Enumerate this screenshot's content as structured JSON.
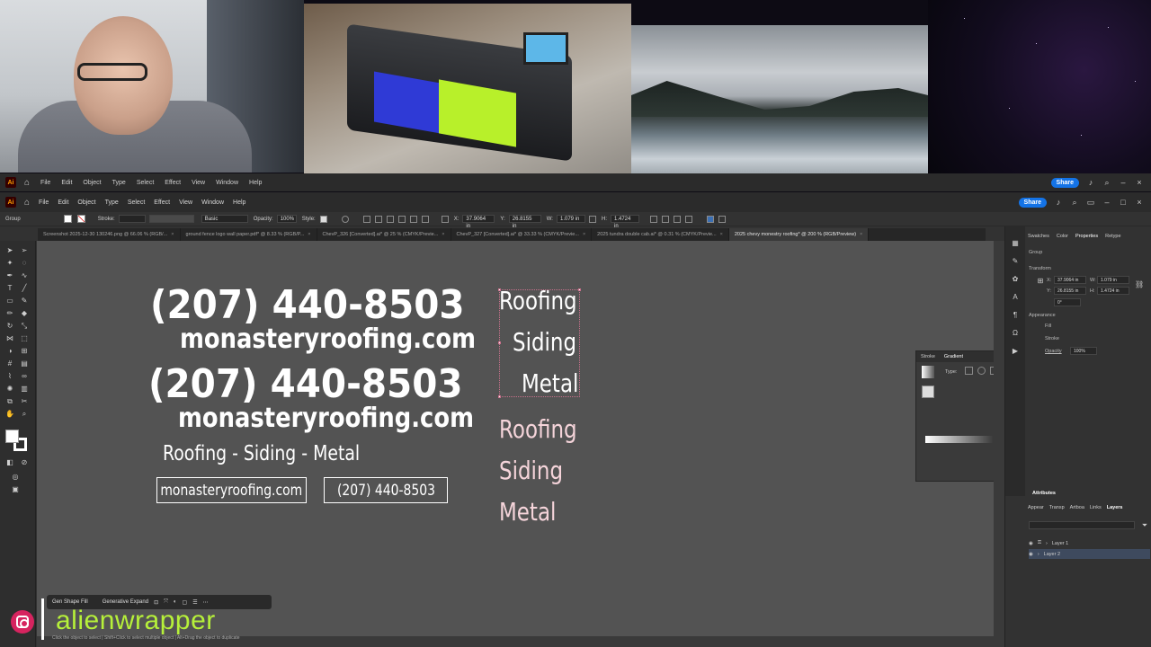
{
  "stream": {
    "handle": "alienwrapper"
  },
  "app": {
    "menu": [
      "File",
      "Edit",
      "Object",
      "Type",
      "Select",
      "Effect",
      "View",
      "Window",
      "Help"
    ],
    "share_label": "Share"
  },
  "control_bar": {
    "group_label": "Group",
    "stroke_label": "Stroke:",
    "brush_value": "Basic",
    "opacity_label": "Opacity:",
    "opacity_value": "100%",
    "style_label": "Style:",
    "x_value": "37.9064 in",
    "y_value": "26.8155 in",
    "w_value": "1.079 in",
    "h_value": "1.4724 in"
  },
  "tabs": [
    {
      "label": "Screenshot 2025-12-30 130246.png @ 66.06 % (RGB/..."
    },
    {
      "label": "ground fence logo wall paper.pdf* @ 8.33 % (RGB/P..."
    },
    {
      "label": "ChevP_326 [Converted].ai* @ 25 % (CMYK/Previe..."
    },
    {
      "label": "ChevP_327 [Converted].ai* @ 33.33 % (CMYK/Previe..."
    },
    {
      "label": "2025 tundra double cab.ai* @ 0.31 % (CMYK/Previe..."
    },
    {
      "label": "2025 chevy monestry roofing* @ 200 % (RGB/Preview)"
    }
  ],
  "artboard": {
    "phone": "(207) 440-8503",
    "url": "monasteryroofing.com",
    "tagline": "Roofing - Siding - Metal",
    "boxed_url": "monasteryroofing.com",
    "boxed_phone": "(207) 440-8503",
    "stack_right": [
      "Roofing",
      "Siding",
      "Metal"
    ],
    "stack_left": [
      "Roofing",
      "Siding",
      "Metal"
    ]
  },
  "gradient_panel": {
    "tab_stroke": "Stroke",
    "tab_gradient": "Gradient",
    "type_label": "Type:"
  },
  "properties": {
    "tabs": [
      "Swatches",
      "Color",
      "Properties",
      "Retype"
    ],
    "group_label": "Group",
    "transform_label": "Transform",
    "x_label": "X:",
    "x_value": "37.9064 in",
    "y_label": "Y:",
    "y_value": "26.8155 in",
    "w_label": "W:",
    "w_value": "1.079 in",
    "h_label": "H:",
    "h_value": "1.4724 in",
    "angle_value": "0°",
    "appearance_label": "Appearance",
    "fill_label": "Fill",
    "stroke_label": "Stroke",
    "opacity_label": "Opacity",
    "opacity_value": "100%",
    "attributes_label": "Attributes"
  },
  "layers_panel": {
    "tabs": [
      "Appear",
      "Transp",
      "Artboa",
      "Links",
      "Layers"
    ],
    "layers": [
      "Layer 1",
      "Layer 2"
    ]
  },
  "context_bar": {
    "gen_fill": "Gen Shape Fill",
    "gen_expand": "Generative Expand"
  },
  "status": {
    "hint": "Click the object to select  |  Shift+Click to select multiple object  |  Alt+Drag the object to duplicate"
  },
  "colors": {
    "accent": "#1473e6",
    "handle": "#b6f03a",
    "selection": "#c9718c"
  }
}
